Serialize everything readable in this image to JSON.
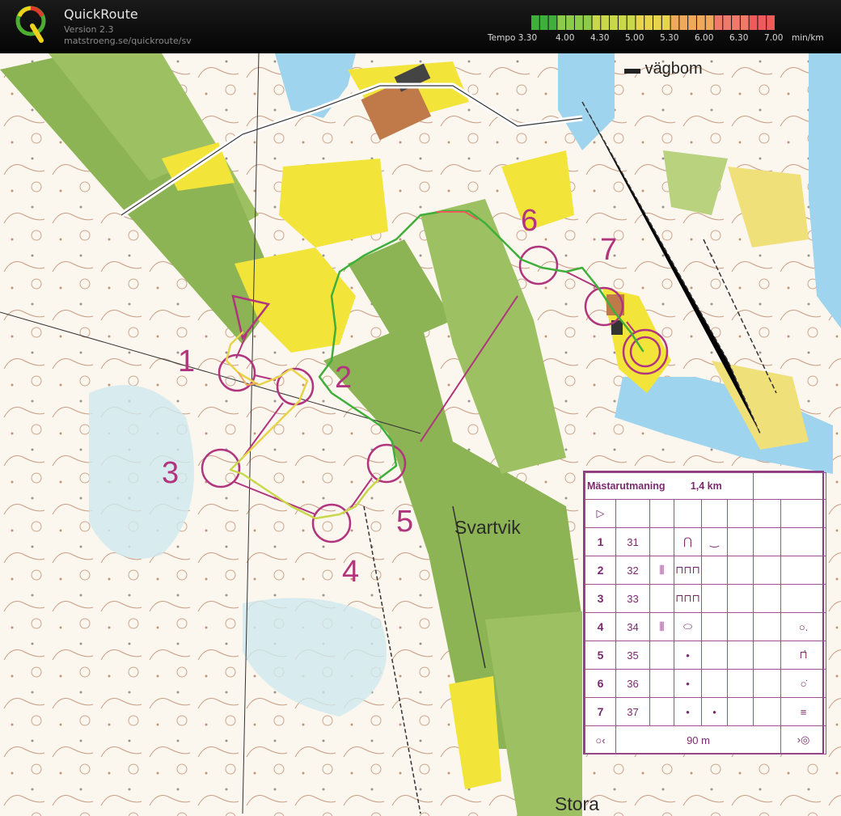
{
  "app": {
    "title": "QuickRoute",
    "version": "Version 2.3",
    "url": "matstroeng.se/quickroute/sv"
  },
  "legend": {
    "labels": [
      "Tempo 3.30",
      "4.00",
      "4.30",
      "5.00",
      "5.30",
      "6.00",
      "6.30",
      "7.00",
      "min/km"
    ],
    "colors": [
      "#3fae3a",
      "#8ccc4a",
      "#c8d84a",
      "#e7d44a",
      "#f0a85a",
      "#f07a6a",
      "#f05a5a"
    ]
  },
  "map": {
    "labels": {
      "vagbom": "vägbom",
      "svartvik": "Svartvik",
      "stora": "Stora"
    },
    "control_numbers": [
      "1",
      "2",
      "3",
      "4",
      "5",
      "6",
      "7"
    ],
    "colors": {
      "forest_green": "#8cb455",
      "open_yellow": "#f3e43a",
      "water_blue": "#9fd4ee",
      "course_magenta": "#b0357e",
      "contour_brown": "#a0522d"
    }
  },
  "description_sheet": {
    "title": "Mästarutmaning",
    "length": "1,4 km",
    "start_symbol": "▷",
    "rows": [
      {
        "num": "1",
        "code": "31",
        "col_d": "",
        "col_e": "⋂",
        "col_f": "‿",
        "col_g": ""
      },
      {
        "num": "2",
        "code": "32",
        "col_d": "⫼",
        "col_e": "⊓⊓⊓",
        "col_f": "",
        "col_g": ""
      },
      {
        "num": "3",
        "code": "33",
        "col_d": "",
        "col_e": "⊓⊓⊓",
        "col_f": "",
        "col_g": ""
      },
      {
        "num": "4",
        "code": "34",
        "col_d": "⫼",
        "col_e": "⬭",
        "col_f": "",
        "col_g": "○."
      },
      {
        "num": "5",
        "code": "35",
        "col_d": "",
        "col_e": "•",
        "col_f": "",
        "col_g": "⊓̇"
      },
      {
        "num": "6",
        "code": "36",
        "col_d": "",
        "col_e": "•",
        "col_f": "",
        "col_g": "○̇"
      },
      {
        "num": "7",
        "code": "37",
        "col_d": "",
        "col_e": "•",
        "col_f": "•",
        "col_g": "≡"
      }
    ],
    "finish": {
      "left_symbol": "○‹",
      "distance": "90 m",
      "right_symbol": "›◎"
    }
  }
}
